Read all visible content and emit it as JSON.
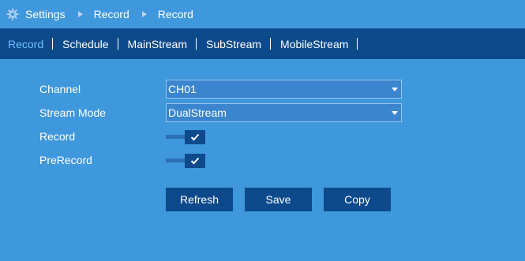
{
  "breadcrumb": {
    "icon": "gear-icon",
    "items": [
      "Settings",
      "Record",
      "Record"
    ]
  },
  "tabs": [
    {
      "label": "Record",
      "active": true
    },
    {
      "label": "Schedule",
      "active": false
    },
    {
      "label": "MainStream",
      "active": false
    },
    {
      "label": "SubStream",
      "active": false
    },
    {
      "label": "MobileStream",
      "active": false
    }
  ],
  "form": {
    "channel": {
      "label": "Channel",
      "value": "CH01"
    },
    "stream_mode": {
      "label": "Stream Mode",
      "value": "DualStream"
    },
    "record": {
      "label": "Record",
      "checked": true
    },
    "prerecord": {
      "label": "PreRecord",
      "checked": true
    }
  },
  "buttons": {
    "refresh": "Refresh",
    "save": "Save",
    "copy": "Copy"
  },
  "colors": {
    "background": "#3f97dc",
    "tabbar": "#0d4a8c",
    "active_tab": "#6cc0ff",
    "button": "#0d4a8c"
  }
}
